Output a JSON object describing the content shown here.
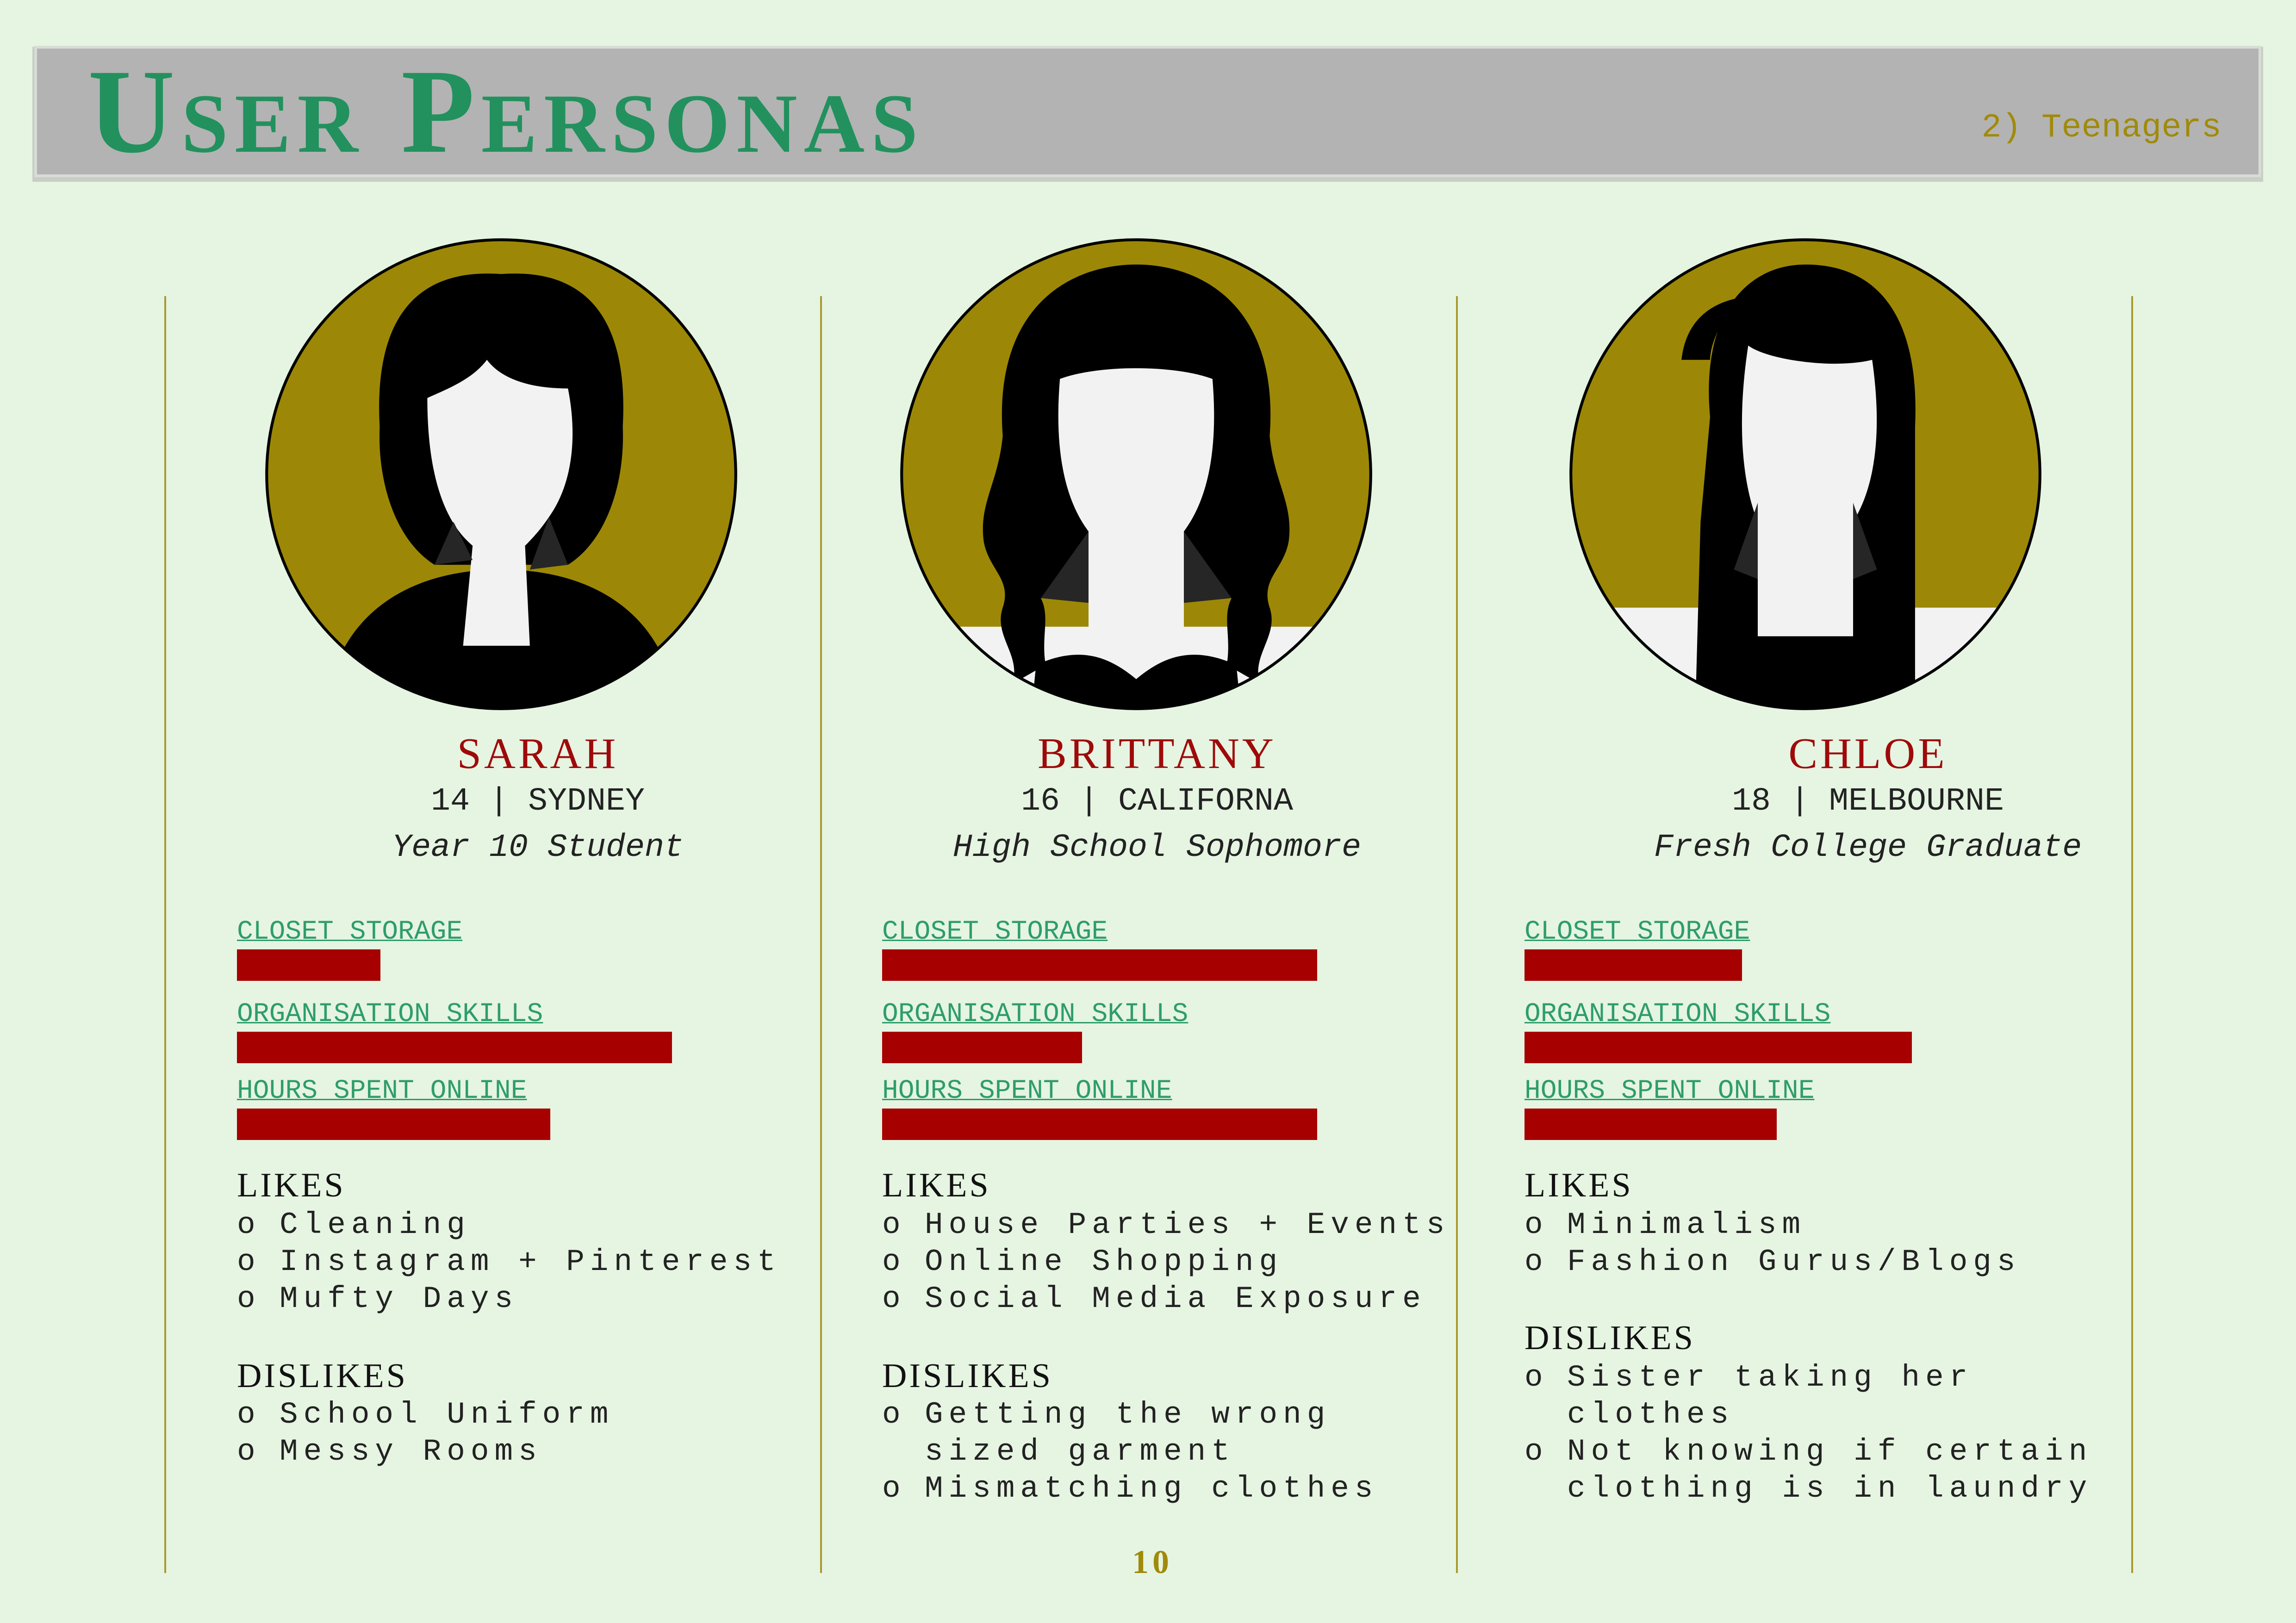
{
  "header": {
    "title": "User Personas",
    "subtitle": "2) Teenagers"
  },
  "page_number": "10",
  "colors": {
    "background": "#e6f4e2",
    "header_bar": "#b3b3b3",
    "title_green": "#22915e",
    "accent_gold": "#a08a0a",
    "name_red": "#9e0a0a",
    "bar_red": "#a60000",
    "avatar_ring": "#9c8806"
  },
  "metric_labels": {
    "closet": "CLOSET STORAGE",
    "organisation": "ORGANISATION SKILLS",
    "online": "HOURS SPENT ONLINE"
  },
  "section_labels": {
    "likes": "LIKES",
    "dislikes": "DISLIKES"
  },
  "personas": [
    {
      "avatar_icon": "female-silhouette-bob-icon",
      "name": "SARAH",
      "age_location": "14 | SYDNEY",
      "role": "Year 10 Student",
      "metrics": {
        "closet": 0.33,
        "organisation": 1.0,
        "online": 0.72
      },
      "likes": [
        "Cleaning",
        "Instagram + Pinterest",
        "Mufty Days"
      ],
      "dislikes": [
        "School Uniform",
        "Messy Rooms"
      ]
    },
    {
      "avatar_icon": "female-silhouette-wavy-hair-icon",
      "name": "BRITTANY",
      "age_location": "16 | CALIFORNA",
      "role": "High School Sophomore",
      "metrics": {
        "closet": 1.0,
        "organisation": 0.46,
        "online": 1.0
      },
      "likes": [
        "House Parties + Events",
        "Online Shopping",
        "Social Media Exposure"
      ],
      "dislikes": [
        "Getting the wrong",
        "sized garment",
        "Mismatching clothes"
      ]
    },
    {
      "avatar_icon": "female-silhouette-long-hair-icon",
      "name": "CHLOE",
      "age_location": "18 | MELBOURNE",
      "role": "Fresh College Graduate",
      "metrics": {
        "closet": 0.5,
        "organisation": 0.89,
        "online": 0.58
      },
      "likes": [
        "Minimalism",
        "Fashion Gurus/Blogs"
      ],
      "dislikes": [
        "Sister taking her",
        "clothes",
        "Not knowing if certain",
        "clothing is in laundry"
      ]
    }
  ]
}
